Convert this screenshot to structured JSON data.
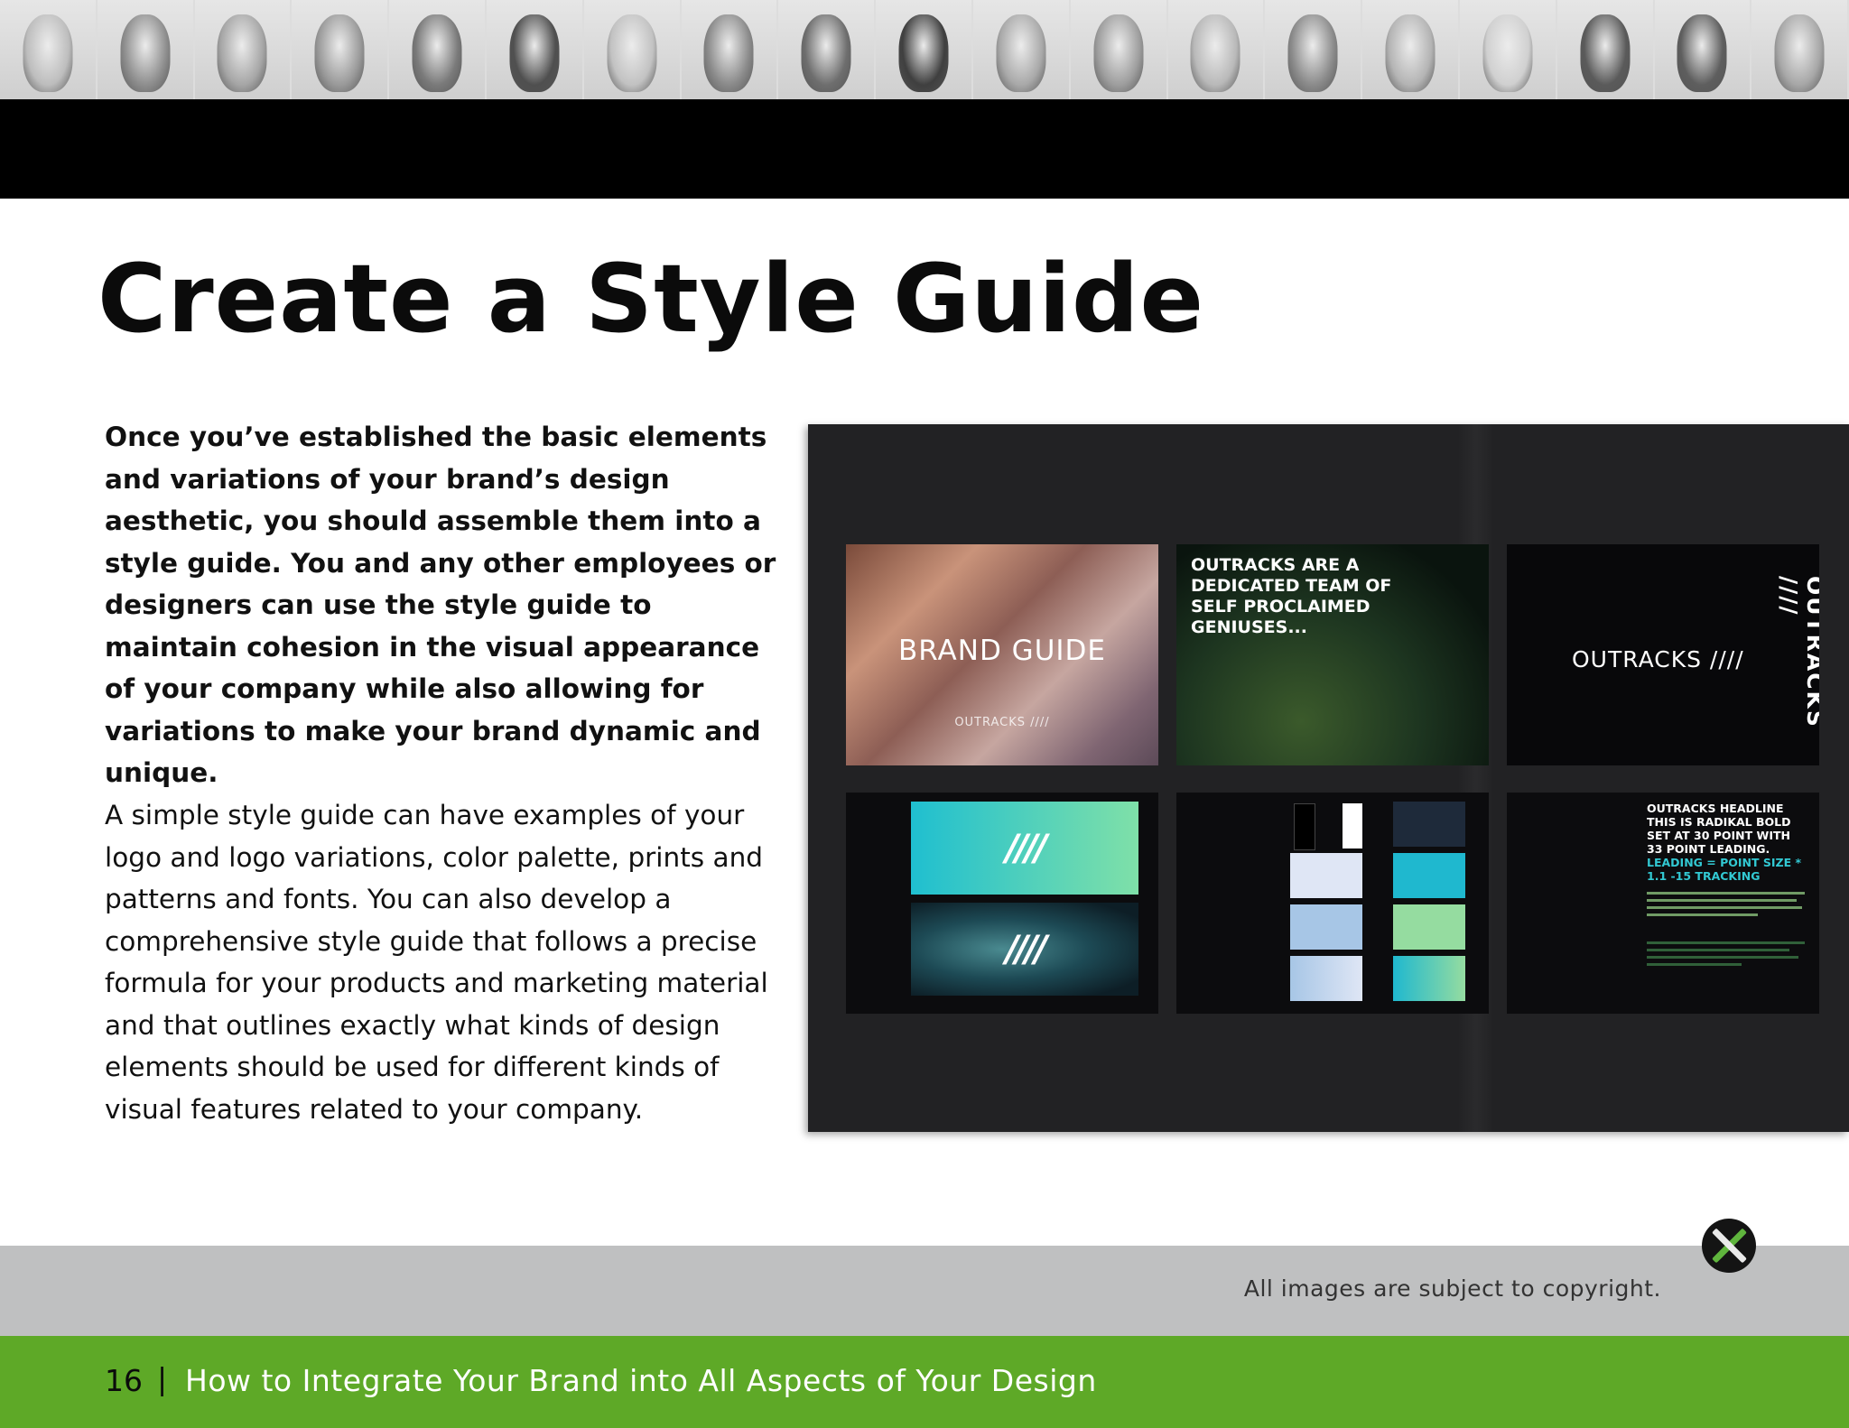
{
  "header": {
    "photo_tones": [
      "#bdbdbd",
      "#8e8e8e",
      "#a6a6a6",
      "#9a9a9a",
      "#7a7a7a",
      "#4f4f4f",
      "#c2c2c2",
      "#8a8a8a",
      "#6e6e6e",
      "#3f3f3f",
      "#a9a9a9",
      "#9e9e9e",
      "#b9b9b9",
      "#8b8b8b",
      "#b4b4b4",
      "#d0d0d0",
      "#5a5a5a",
      "#5e5e5e",
      "#a7a7a7"
    ]
  },
  "page": {
    "title": "Create a Style Guide",
    "intro": "Once you’ve established the basic elements and variations of your brand’s design aesthetic, you should assemble them into a style guide. You and any other employees or designers can use the style guide to maintain cohesion in the visual appearance of your company while also allowing for variations to make your brand dynamic and unique.",
    "body": "A simple style guide can have examples of your logo and logo variations, color palette, prints and patterns and fonts. You can also develop a comprehensive style guide that follows a precise formula for your products and marketing material and that outlines exactly what kinds of design elements should be used for different kinds of visual features related to your company."
  },
  "mockup": {
    "slide1_title": "BRAND GUIDE",
    "slide1_logo": "OUTRACKS ////",
    "slide2_text": "OUTRACKS ARE A DEDICATED TEAM OF SELF PROCLAIMED GENIUSES...",
    "slide3_logo_h": "OUTRACKS ////",
    "slide3_logo_v": "OUTRACKS ////",
    "slide4_symbol": "////",
    "slide6_head_1": "OUTRACKS HEADLINE THIS IS RADIKAL BOLD SET AT 30 POINT WITH 33 POINT LEADING.",
    "slide6_head_2": "LEADING = POINT SIZE * 1.1 -15 TRACKING",
    "palette": [
      "#1e2a3a",
      "#1fb8cf",
      "#95dca0",
      "#62c6c9",
      "#dfe6f5",
      "#a7c6e6",
      "#c9ddf0"
    ]
  },
  "footer": {
    "copyright": "All images are subject to copyright.",
    "page_number": "16",
    "separator": "|",
    "book_title": "How to Integrate Your Brand into All Aspects of Your Design"
  }
}
